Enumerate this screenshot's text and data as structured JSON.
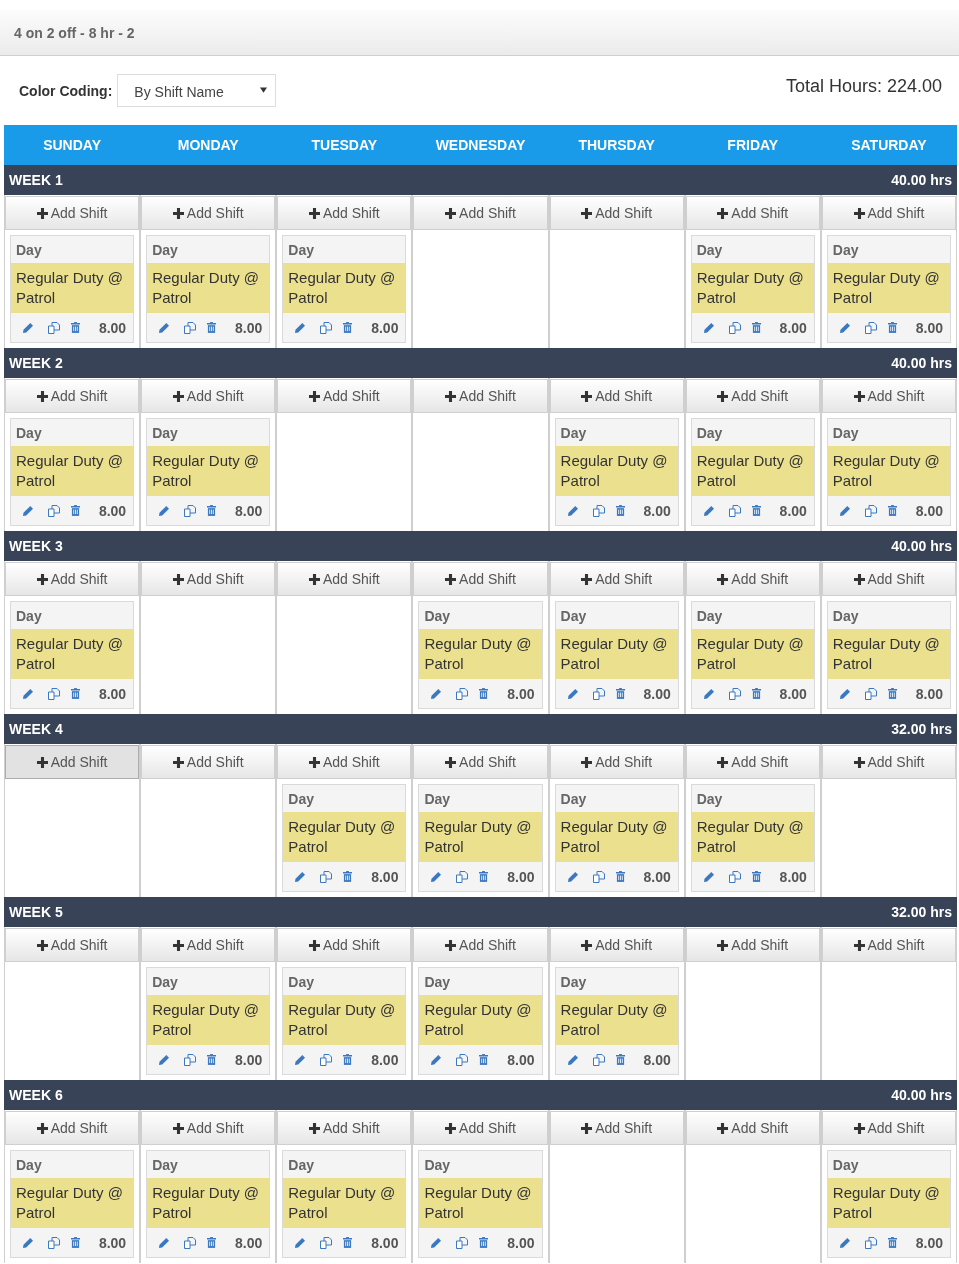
{
  "header": {
    "title": "4 on 2 off - 8 hr - 2"
  },
  "toolbar": {
    "color_coding_label": "Color Coding:",
    "color_coding_value": "By Shift Name",
    "total_hours": "Total Hours: 224.00"
  },
  "calendar": {
    "days": [
      "SUNDAY",
      "MONDAY",
      "TUESDAY",
      "WEDNESDAY",
      "THURSDAY",
      "FRIDAY",
      "SATURDAY"
    ],
    "weeks": [
      {
        "label": "WEEK 1",
        "hours": "40.00 hrs",
        "days": [
          {
            "add_label": "Add Shift",
            "hovered": false,
            "shifts": [
              {
                "name": "Day",
                "description": "Regular Duty @ Patrol",
                "hours": "8.00"
              }
            ]
          },
          {
            "add_label": "Add Shift",
            "hovered": false,
            "shifts": [
              {
                "name": "Day",
                "description": "Regular Duty @ Patrol",
                "hours": "8.00"
              }
            ]
          },
          {
            "add_label": "Add Shift",
            "hovered": false,
            "shifts": [
              {
                "name": "Day",
                "description": "Regular Duty @ Patrol",
                "hours": "8.00"
              }
            ]
          },
          {
            "add_label": "Add Shift",
            "hovered": false
          },
          {
            "add_label": "Add Shift",
            "hovered": false
          },
          {
            "add_label": "Add Shift",
            "hovered": false,
            "shifts": [
              {
                "name": "Day",
                "description": "Regular Duty @ Patrol",
                "hours": "8.00"
              }
            ]
          },
          {
            "add_label": "Add Shift",
            "hovered": false,
            "shifts": [
              {
                "name": "Day",
                "description": "Regular Duty @ Patrol",
                "hours": "8.00"
              }
            ]
          }
        ]
      },
      {
        "label": "WEEK 2",
        "hours": "40.00 hrs",
        "days": [
          {
            "add_label": "Add Shift",
            "hovered": false,
            "shifts": [
              {
                "name": "Day",
                "description": "Regular Duty @ Patrol",
                "hours": "8.00"
              }
            ]
          },
          {
            "add_label": "Add Shift",
            "hovered": false,
            "shifts": [
              {
                "name": "Day",
                "description": "Regular Duty @ Patrol",
                "hours": "8.00"
              }
            ]
          },
          {
            "add_label": "Add Shift",
            "hovered": false
          },
          {
            "add_label": "Add Shift",
            "hovered": false
          },
          {
            "add_label": "Add Shift",
            "hovered": false,
            "shifts": [
              {
                "name": "Day",
                "description": "Regular Duty @ Patrol",
                "hours": "8.00"
              }
            ]
          },
          {
            "add_label": "Add Shift",
            "hovered": false,
            "shifts": [
              {
                "name": "Day",
                "description": "Regular Duty @ Patrol",
                "hours": "8.00"
              }
            ]
          },
          {
            "add_label": "Add Shift",
            "hovered": false,
            "shifts": [
              {
                "name": "Day",
                "description": "Regular Duty @ Patrol",
                "hours": "8.00"
              }
            ]
          }
        ]
      },
      {
        "label": "WEEK 3",
        "hours": "40.00 hrs",
        "days": [
          {
            "add_label": "Add Shift",
            "hovered": false,
            "shifts": [
              {
                "name": "Day",
                "description": "Regular Duty @ Patrol",
                "hours": "8.00"
              }
            ]
          },
          {
            "add_label": "Add Shift",
            "hovered": false
          },
          {
            "add_label": "Add Shift",
            "hovered": false
          },
          {
            "add_label": "Add Shift",
            "hovered": false,
            "shifts": [
              {
                "name": "Day",
                "description": "Regular Duty @ Patrol",
                "hours": "8.00"
              }
            ]
          },
          {
            "add_label": "Add Shift",
            "hovered": false,
            "shifts": [
              {
                "name": "Day",
                "description": "Regular Duty @ Patrol",
                "hours": "8.00"
              }
            ]
          },
          {
            "add_label": "Add Shift",
            "hovered": false,
            "shifts": [
              {
                "name": "Day",
                "description": "Regular Duty @ Patrol",
                "hours": "8.00"
              }
            ]
          },
          {
            "add_label": "Add Shift",
            "hovered": false,
            "shifts": [
              {
                "name": "Day",
                "description": "Regular Duty @ Patrol",
                "hours": "8.00"
              }
            ]
          }
        ]
      },
      {
        "label": "WEEK 4",
        "hours": "32.00 hrs",
        "days": [
          {
            "add_label": "Add Shift",
            "hovered": true
          },
          {
            "add_label": "Add Shift",
            "hovered": false
          },
          {
            "add_label": "Add Shift",
            "hovered": false,
            "shifts": [
              {
                "name": "Day",
                "description": "Regular Duty @ Patrol",
                "hours": "8.00"
              }
            ]
          },
          {
            "add_label": "Add Shift",
            "hovered": false,
            "shifts": [
              {
                "name": "Day",
                "description": "Regular Duty @ Patrol",
                "hours": "8.00"
              }
            ]
          },
          {
            "add_label": "Add Shift",
            "hovered": false,
            "shifts": [
              {
                "name": "Day",
                "description": "Regular Duty @ Patrol",
                "hours": "8.00"
              }
            ]
          },
          {
            "add_label": "Add Shift",
            "hovered": false,
            "shifts": [
              {
                "name": "Day",
                "description": "Regular Duty @ Patrol",
                "hours": "8.00"
              }
            ]
          },
          {
            "add_label": "Add Shift",
            "hovered": false
          }
        ]
      },
      {
        "label": "WEEK 5",
        "hours": "32.00 hrs",
        "days": [
          {
            "add_label": "Add Shift",
            "hovered": false
          },
          {
            "add_label": "Add Shift",
            "hovered": false,
            "shifts": [
              {
                "name": "Day",
                "description": "Regular Duty @ Patrol",
                "hours": "8.00"
              }
            ]
          },
          {
            "add_label": "Add Shift",
            "hovered": false,
            "shifts": [
              {
                "name": "Day",
                "description": "Regular Duty @ Patrol",
                "hours": "8.00"
              }
            ]
          },
          {
            "add_label": "Add Shift",
            "hovered": false,
            "shifts": [
              {
                "name": "Day",
                "description": "Regular Duty @ Patrol",
                "hours": "8.00"
              }
            ]
          },
          {
            "add_label": "Add Shift",
            "hovered": false,
            "shifts": [
              {
                "name": "Day",
                "description": "Regular Duty @ Patrol",
                "hours": "8.00"
              }
            ]
          },
          {
            "add_label": "Add Shift",
            "hovered": false
          },
          {
            "add_label": "Add Shift",
            "hovered": false
          }
        ]
      },
      {
        "label": "WEEK 6",
        "hours": "40.00 hrs",
        "days": [
          {
            "add_label": "Add Shift",
            "hovered": false,
            "shifts": [
              {
                "name": "Day",
                "description": "Regular Duty @ Patrol",
                "hours": "8.00"
              }
            ]
          },
          {
            "add_label": "Add Shift",
            "hovered": false,
            "shifts": [
              {
                "name": "Day",
                "description": "Regular Duty @ Patrol",
                "hours": "8.00"
              }
            ]
          },
          {
            "add_label": "Add Shift",
            "hovered": false,
            "shifts": [
              {
                "name": "Day",
                "description": "Regular Duty @ Patrol",
                "hours": "8.00"
              }
            ]
          },
          {
            "add_label": "Add Shift",
            "hovered": false,
            "shifts": [
              {
                "name": "Day",
                "description": "Regular Duty @ Patrol",
                "hours": "8.00"
              }
            ]
          },
          {
            "add_label": "Add Shift",
            "hovered": false
          },
          {
            "add_label": "Add Shift",
            "hovered": false
          },
          {
            "add_label": "Add Shift",
            "hovered": false,
            "shifts": [
              {
                "name": "Day",
                "description": "Regular Duty @ Patrol",
                "hours": "8.00"
              }
            ]
          }
        ]
      }
    ]
  }
}
